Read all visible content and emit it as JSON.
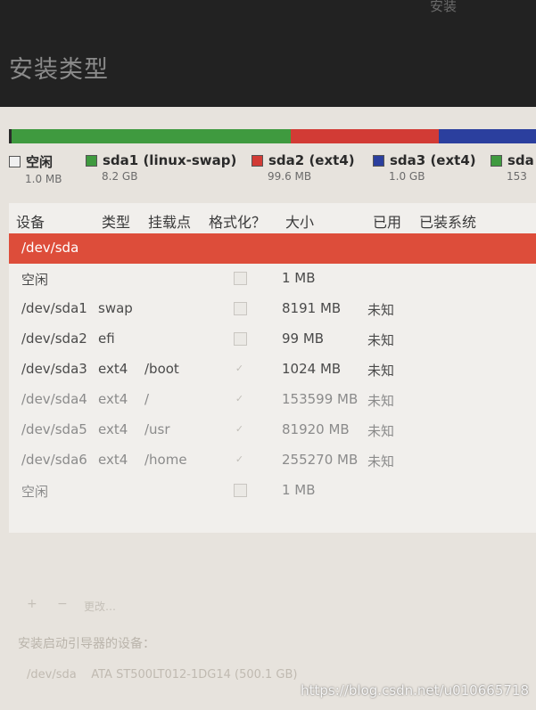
{
  "window": {
    "title": "安装"
  },
  "page": {
    "title": "安装类型"
  },
  "partition_bar": {
    "segments": [
      {
        "name": "free",
        "color": "#2a2a2a",
        "weight": 0.5
      },
      {
        "name": "sda1",
        "color": "#3f9a3f",
        "weight": 53
      },
      {
        "name": "sda2",
        "color": "#d23b35",
        "weight": 28
      },
      {
        "name": "sda3",
        "color": "#2b3f9e",
        "weight": 18.5
      }
    ]
  },
  "legend": [
    {
      "name": "空闲",
      "size": "1.0 MB",
      "color": "#f0f0f0"
    },
    {
      "name": "sda1 (linux-swap)",
      "size": "8.2 GB",
      "color": "#3f9a3f"
    },
    {
      "name": "sda2 (ext4)",
      "size": "99.6 MB",
      "color": "#d23b35"
    },
    {
      "name": "sda3 (ext4)",
      "size": "1.0 GB",
      "color": "#2b3f9e"
    },
    {
      "name": "sda",
      "size": "153",
      "color": "#3f9a3f"
    }
  ],
  "table": {
    "headers": {
      "device": "设备",
      "type": "类型",
      "mount": "挂载点",
      "format": "格式化？",
      "size": "大小",
      "used": "已用",
      "installed": "已装系统"
    },
    "rows": [
      {
        "device": "/dev/sda",
        "type": "",
        "mount": "",
        "format": "",
        "size": "",
        "used": "",
        "selected": true
      },
      {
        "device": "空闲",
        "type": "",
        "mount": "",
        "format": "unchecked",
        "size": "1 MB",
        "used": ""
      },
      {
        "device": "/dev/sda1",
        "type": "swap",
        "mount": "",
        "format": "unchecked",
        "size": "8191 MB",
        "used": "未知"
      },
      {
        "device": "/dev/sda2",
        "type": "efi",
        "mount": "",
        "format": "unchecked",
        "size": "99 MB",
        "used": "未知"
      },
      {
        "device": "/dev/sda3",
        "type": "ext4",
        "mount": "/boot",
        "format": "checked",
        "size": "1024 MB",
        "used": "未知"
      },
      {
        "device": "/dev/sda4",
        "type": "ext4",
        "mount": "/",
        "format": "checked",
        "size": "153599 MB",
        "used": "未知"
      },
      {
        "device": "/dev/sda5",
        "type": "ext4",
        "mount": "/usr",
        "format": "checked",
        "size": "81920 MB",
        "used": "未知"
      },
      {
        "device": "/dev/sda6",
        "type": "ext4",
        "mount": "/home",
        "format": "checked",
        "size": "255270 MB",
        "used": "未知"
      },
      {
        "device": "空闲",
        "type": "",
        "mount": "",
        "format": "unchecked",
        "size": "1 MB",
        "used": ""
      }
    ]
  },
  "controls": {
    "add": "+",
    "remove": "−",
    "change": "更改…"
  },
  "bootloader": {
    "label": "安装启动引导器的设备：",
    "device": "/dev/sda",
    "model": "ATA ST500LT012-1DG14 (500.1 GB)"
  },
  "watermark": "https://blog.csdn.net/u010665718"
}
